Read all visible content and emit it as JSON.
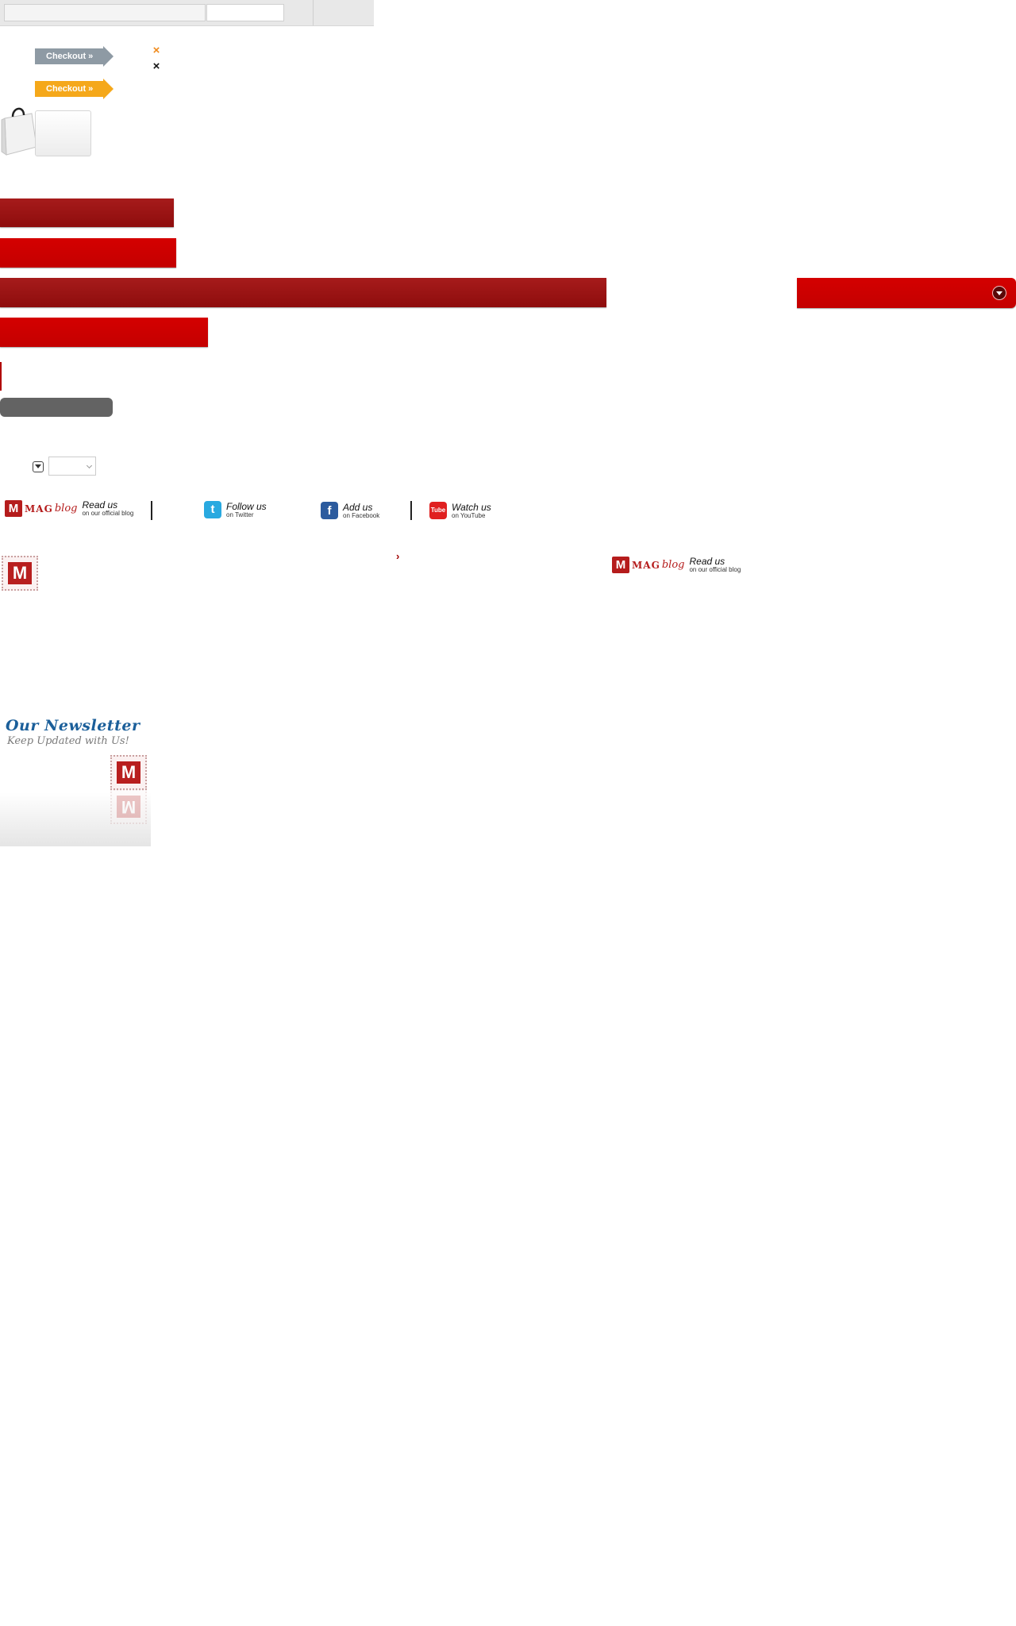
{
  "checkout": {
    "primary_label": "Checkout »",
    "secondary_label": "Checkout »"
  },
  "social": {
    "blog_logo_m": "M",
    "blog_logo_mag": "MAG",
    "blog_logo_blog": "blog",
    "blog_main": "Read us",
    "blog_sub": "on our official blog",
    "twitter_icon_glyph": "t",
    "twitter_main": "Follow us",
    "twitter_sub": "on Twitter",
    "facebook_icon_glyph": "f",
    "facebook_main": "Add us",
    "facebook_sub": "on Facebook",
    "youtube_icon_glyph": "Tube",
    "youtube_main": "Watch us",
    "youtube_sub": "on YouTube"
  },
  "blog_banner": {
    "logo_m": "M",
    "logo_mag": "MAG",
    "logo_blog": "blog",
    "main": "Read us",
    "sub": "on our official blog"
  },
  "stamp": {
    "letter": "M"
  },
  "breadcrumb": {
    "chevron": "›"
  },
  "newsletter": {
    "title": "Our Newsletter",
    "subtitle": "Keep Updated with Us!",
    "stamp_letter": "M"
  },
  "colors": {
    "accent_red": "#c40000",
    "dark_red": "#9a1010",
    "checkout_gray": "#8e9aa4",
    "checkout_orange": "#f5a81a",
    "pill_gray": "#636363",
    "newsletter_blue": "#1b5f9a"
  }
}
